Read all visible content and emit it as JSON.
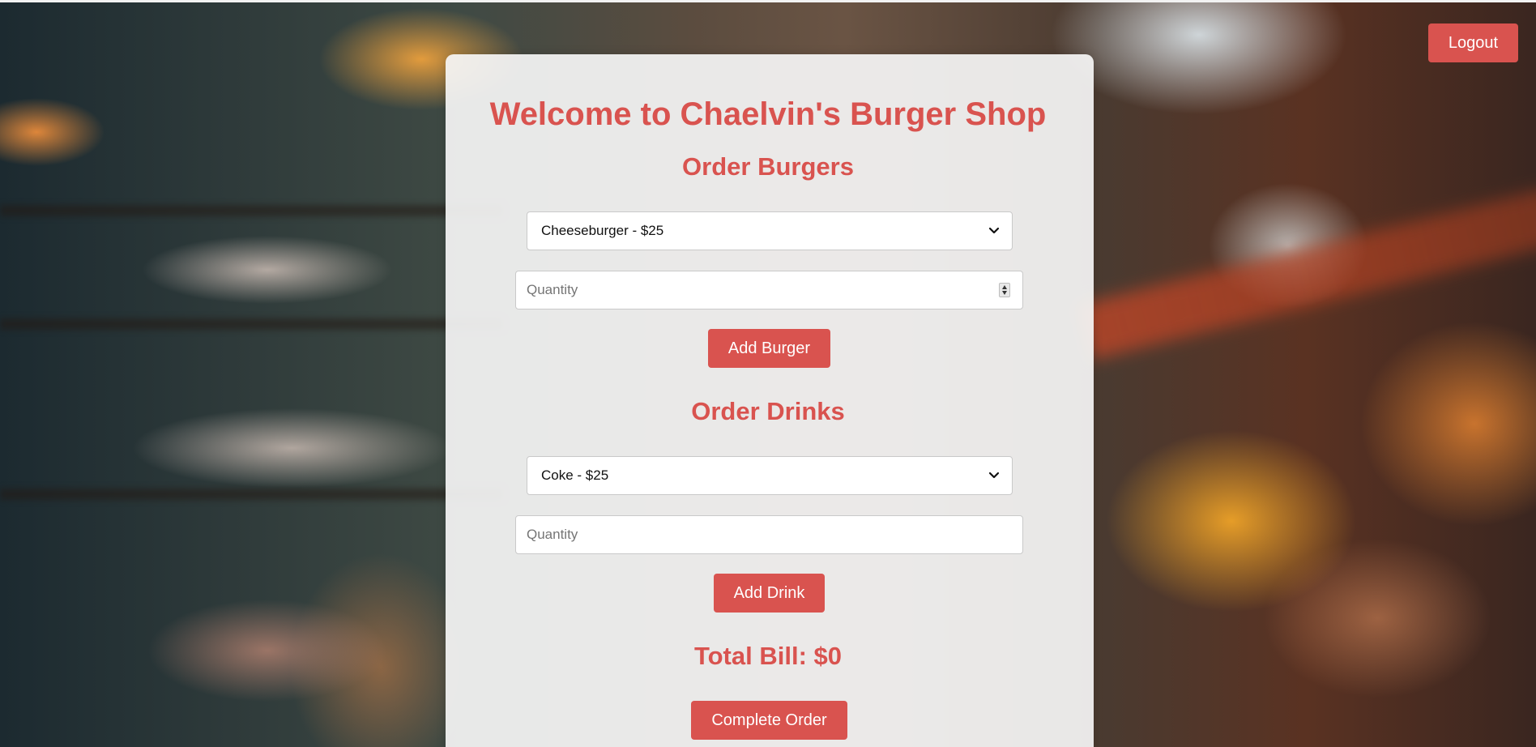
{
  "header": {
    "logout_label": "Logout"
  },
  "main": {
    "title": "Welcome to Chaelvin's Burger Shop",
    "burgers": {
      "heading": "Order Burgers",
      "selected": "Cheeseburger - $25",
      "quantity_placeholder": "Quantity",
      "add_label": "Add Burger"
    },
    "drinks": {
      "heading": "Order Drinks",
      "selected": "Coke - $25",
      "quantity_placeholder": "Quantity",
      "add_label": "Add Drink"
    },
    "total": "Total Bill: $0",
    "complete_label": "Complete Order"
  },
  "colors": {
    "accent": "#d9534f",
    "panel": "#f6f6f6"
  },
  "icons": {
    "select_arrow": "chevron-down-icon",
    "number_spinner": "stepper-icon"
  }
}
